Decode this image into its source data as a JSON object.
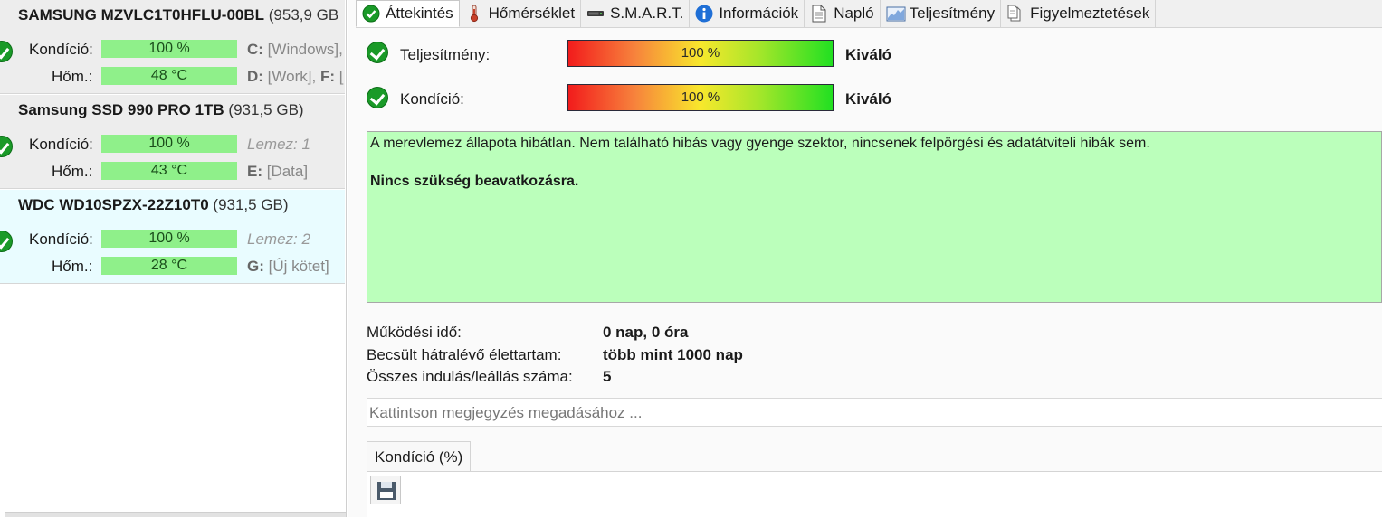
{
  "disks": [
    {
      "model": "SAMSUNG MZVLC1T0HFLU-00BL",
      "capacity": "(953,9 GB",
      "health_label": "Kondíció:",
      "health_value": "100 %",
      "temp_label": "Hőm.:",
      "temp_value": "48 °C",
      "info1_letter": "C:",
      "info1_text": " [Windows],",
      "info2_letter": "D:",
      "info2_text": " [Work], ",
      "info2_letter2": "F:",
      "info2_text2": " [",
      "state": "selected"
    },
    {
      "model": "Samsung SSD 990 PRO 1TB",
      "capacity": "(931,5 GB)",
      "health_label": "Kondíció:",
      "health_value": "100 %",
      "temp_label": "Hőm.:",
      "temp_value": "43 °C",
      "info1_italic": "Lemez: 1",
      "info2_letter": "E:",
      "info2_text": " [Data]",
      "state": "selected"
    },
    {
      "model": "WDC WD10SPZX-22Z10T0",
      "capacity": "(931,5 GB)",
      "health_label": "Kondíció:",
      "health_value": "100 %",
      "temp_label": "Hőm.:",
      "temp_value": "28 °C",
      "info1_italic": "Lemez: 2",
      "info2_letter": "G:",
      "info2_text": " [Új kötet]",
      "state": "hover"
    }
  ],
  "tabs": [
    {
      "label": "Áttekintés",
      "icon": "check-circle-icon",
      "active": true
    },
    {
      "label": "Hőmérséklet",
      "icon": "thermometer-icon"
    },
    {
      "label": "S.M.A.R.T.",
      "icon": "drive-icon"
    },
    {
      "label": "Információk",
      "icon": "info-icon"
    },
    {
      "label": "Napló",
      "icon": "document-icon"
    },
    {
      "label": "Teljesítmény",
      "icon": "performance-chart-icon"
    },
    {
      "label": "Figyelmeztetések",
      "icon": "alerts-icon"
    }
  ],
  "overview": {
    "performance": {
      "label": "Teljesítmény:",
      "value": "100 %",
      "level_percent": 100,
      "grade": "Kiváló"
    },
    "health": {
      "label": "Kondíció:",
      "value": "100 %",
      "level_percent": 100,
      "grade": "Kiváló"
    },
    "status_text": "A merevlemez állapota hibátlan. Nem található hibás vagy gyenge szektor, nincsenek felpörgési és adatátviteli hibák sem.",
    "status_action": "Nincs szükség beavatkozásra.",
    "status_color": "#bbffbb",
    "info_rows": [
      {
        "label": "Működési idő:",
        "value": "0 nap, 0 óra"
      },
      {
        "label": "Becsült hátralévő élettartam:",
        "value": "több mint 1000 nap"
      },
      {
        "label": "Összes indulás/leállás száma:",
        "value": "5"
      }
    ],
    "note_placeholder": "Kattintson megjegyzés megadásához ...",
    "chart_tab": "Kondíció   (%)"
  },
  "colors": {
    "ok_green": "#1a9a28",
    "bar_green": "#8ff08a",
    "hover_row": "#e9fcff"
  }
}
